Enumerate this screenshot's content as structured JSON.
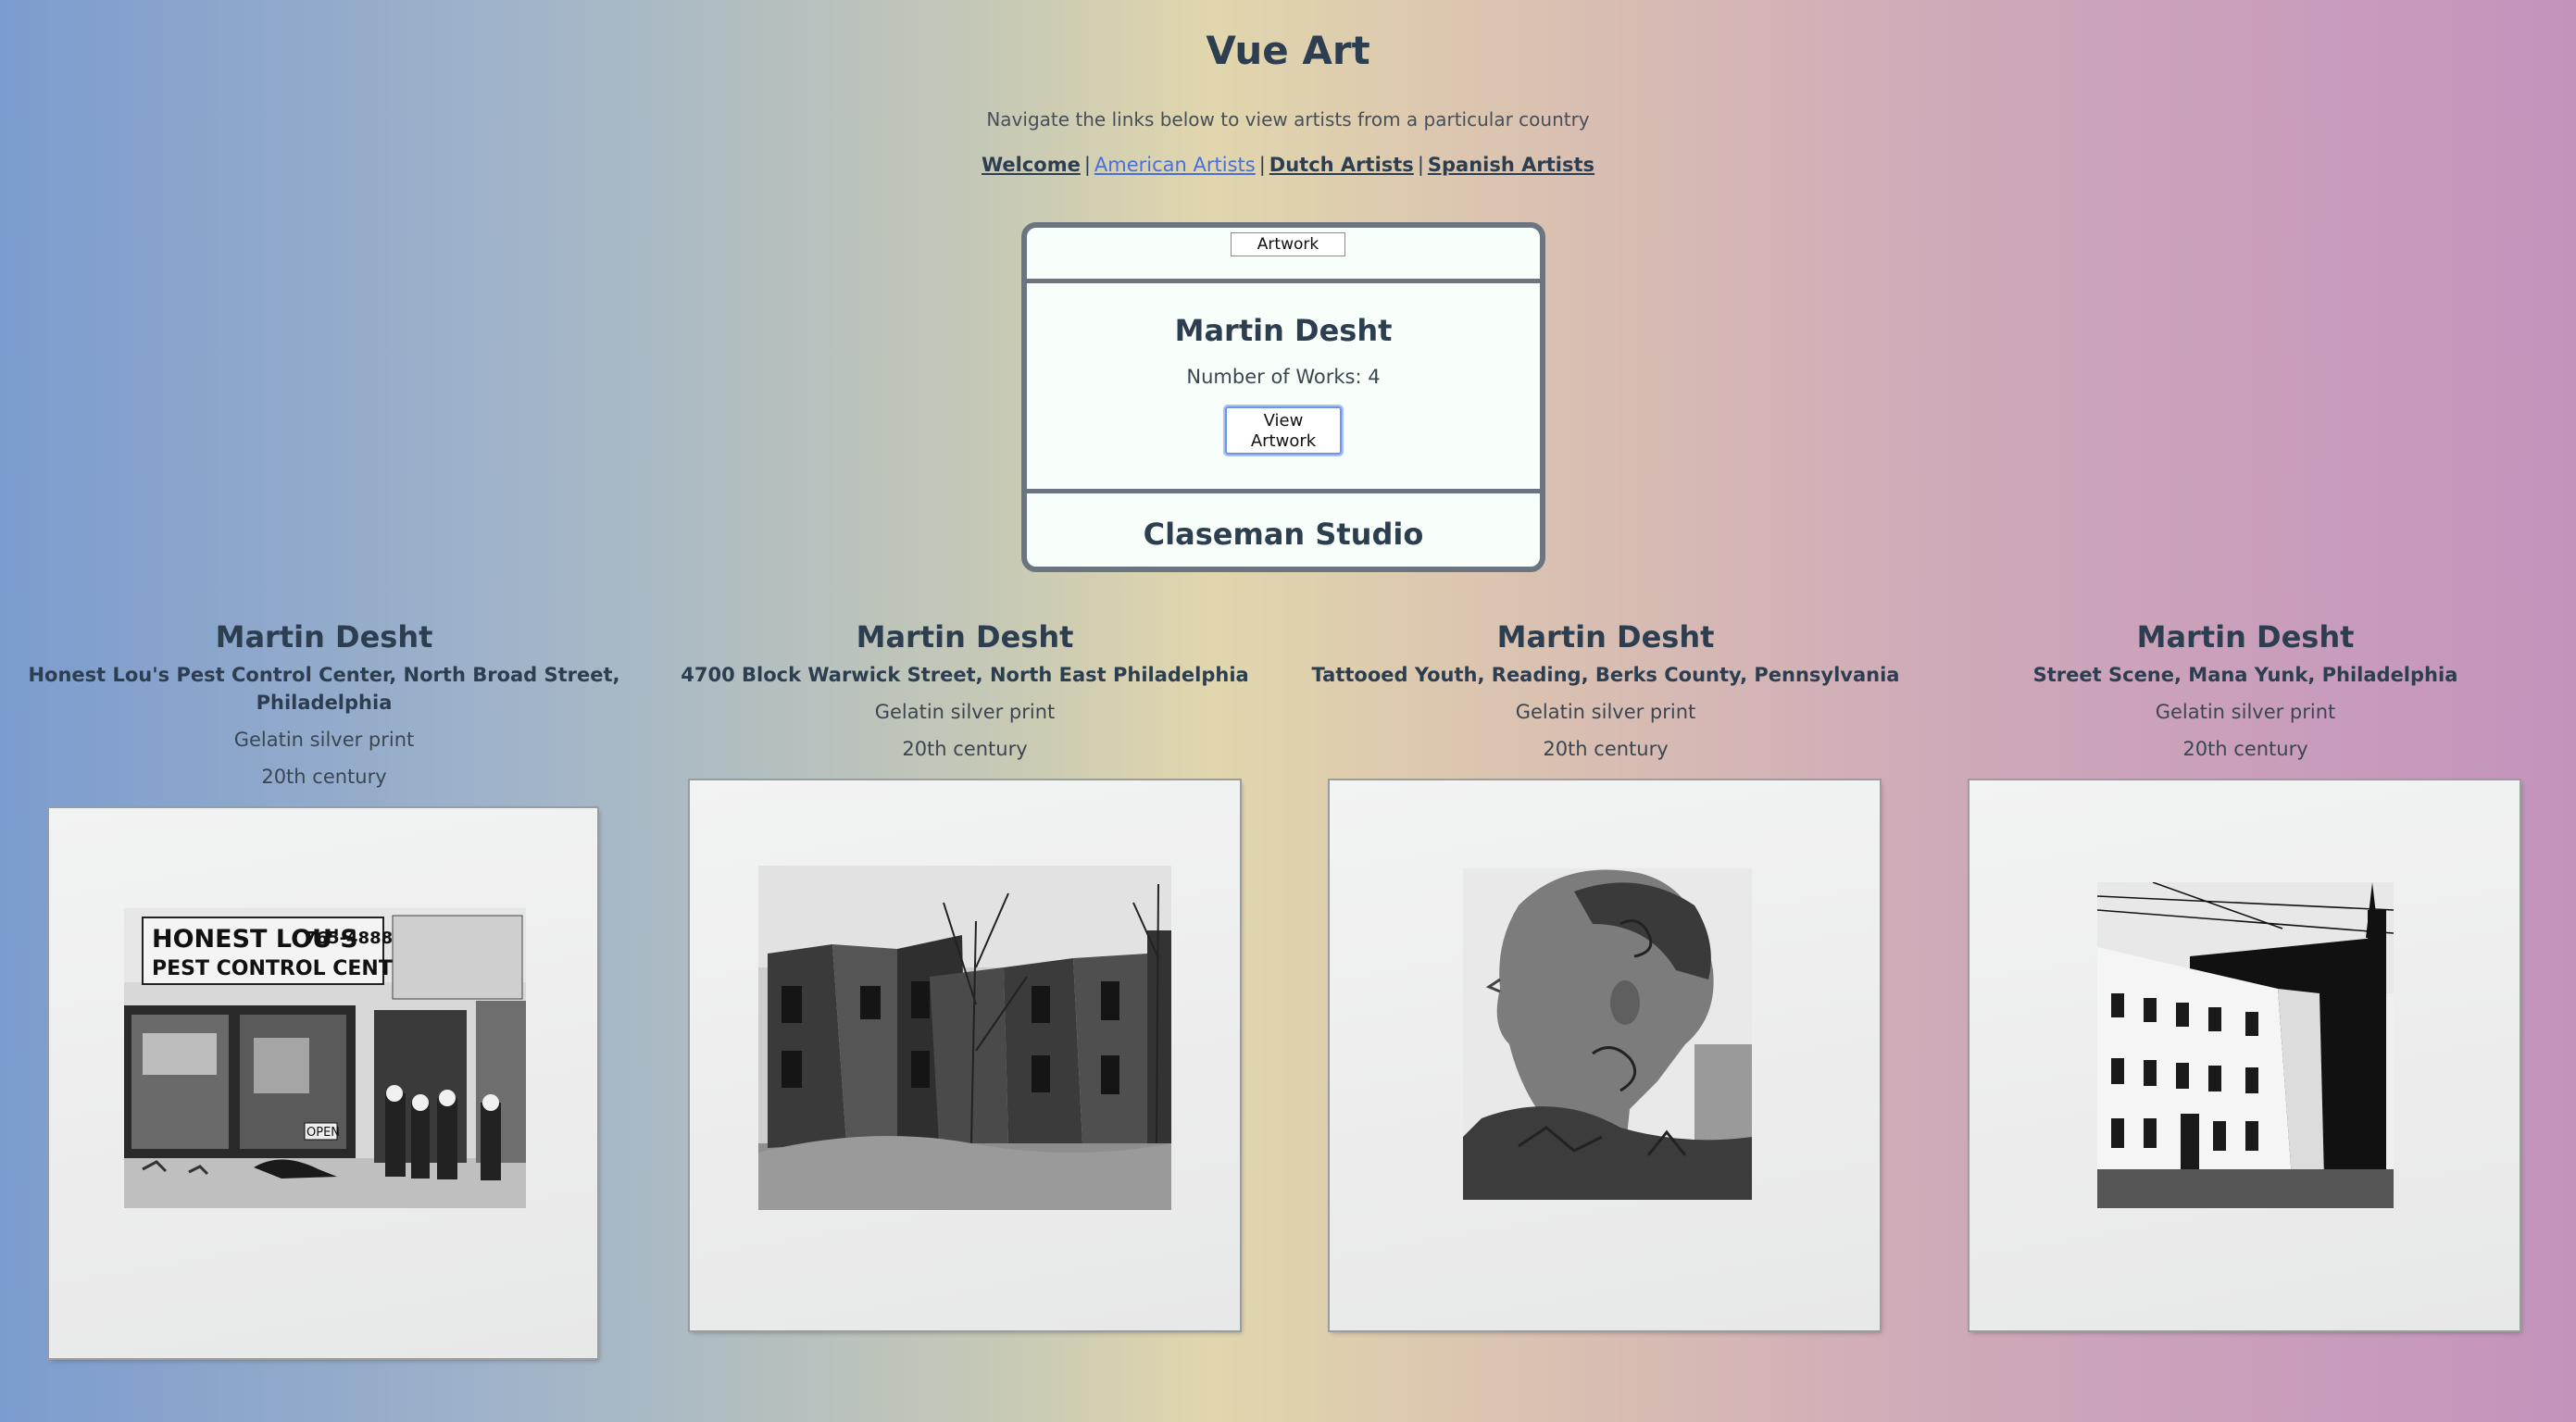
{
  "header": {
    "title": "Vue Art",
    "subtitle": "Navigate the links below to view artists from a particular country"
  },
  "nav": {
    "links": [
      {
        "label": "Welcome",
        "active": false
      },
      {
        "label": "American Artists",
        "active": true
      },
      {
        "label": "Dutch Artists",
        "active": false
      },
      {
        "label": "Spanish Artists",
        "active": false
      }
    ],
    "separator": "|"
  },
  "card": {
    "tab_label": "Artwork",
    "artist_name": "Martin Desht",
    "works_text": "Number of Works: 4",
    "button_label_line1": "View",
    "button_label_line2": "Artwork",
    "next_artist_name": "Claseman Studio",
    "border_color": "#6b7581",
    "background_color": "#f8fffa"
  },
  "gallery": [
    {
      "artist": "Martin Desht",
      "title": "Honest Lou's Pest Control Center, North Broad Street, Philadelphia",
      "medium": "Gelatin silver print",
      "date": "20th century",
      "sign_text_1": "HONEST LOU'S",
      "sign_text_2": "765-4888",
      "sign_text_3": "PEST CONTROL CENTER",
      "door_sign": "OPEN"
    },
    {
      "artist": "Martin Desht",
      "title": "4700 Block Warwick Street, North East Philadelphia",
      "medium": "Gelatin silver print",
      "date": "20th century"
    },
    {
      "artist": "Martin Desht",
      "title": "Tattooed Youth, Reading, Berks County, Pennsylvania",
      "medium": "Gelatin silver print",
      "date": "20th century"
    },
    {
      "artist": "Martin Desht",
      "title": "Street Scene, Mana Yunk, Philadelphia",
      "medium": "Gelatin silver print",
      "date": "20th century"
    }
  ]
}
